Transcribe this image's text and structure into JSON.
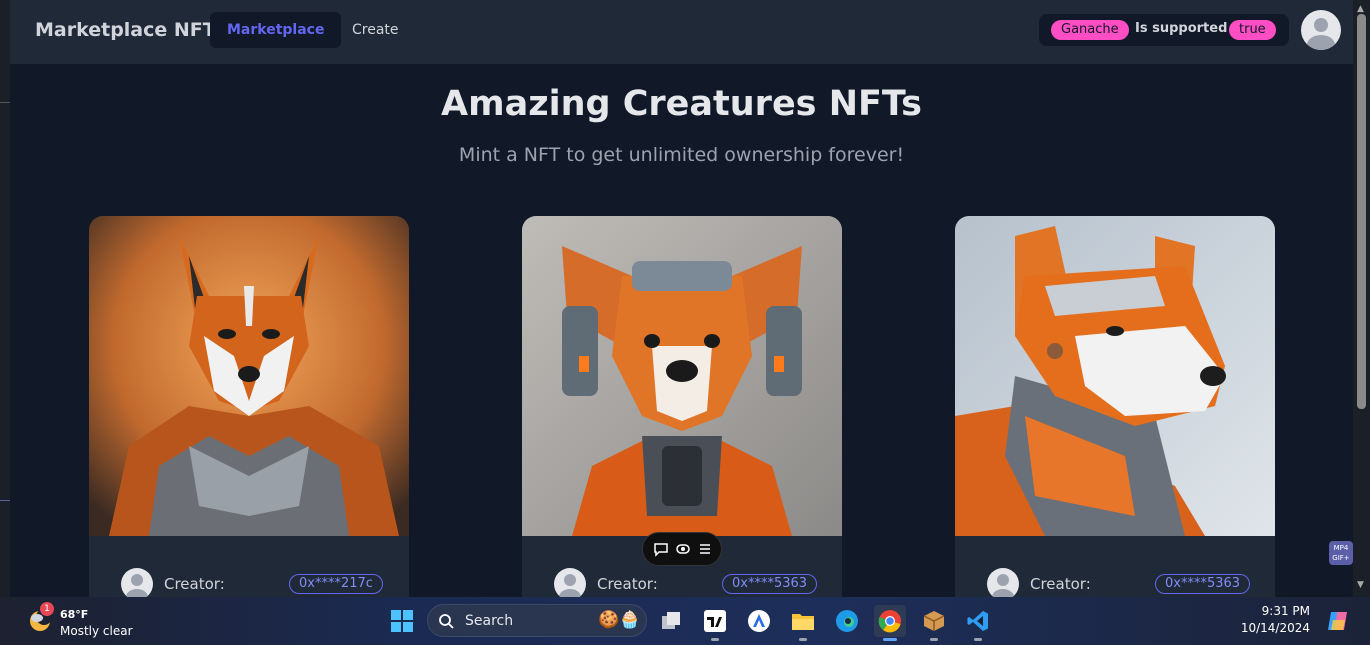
{
  "navbar": {
    "brand": "Marketplace NFT",
    "links": [
      {
        "label": "Marketplace",
        "active": true
      },
      {
        "label": "Create",
        "active": false
      }
    ],
    "network": {
      "name": "Ganache",
      "supported_label": "Is supported :",
      "supported_value": "true"
    }
  },
  "hero": {
    "title": "Amazing Creatures NFTs",
    "subtitle": "Mint a NFT to get unlimited ownership forever!"
  },
  "cards": [
    {
      "creator_label": "Creator:",
      "address": "0x****217c",
      "image": "fox-armor-nft-image"
    },
    {
      "creator_label": "Creator:",
      "address": "0x****5363",
      "image": "robot-dog-nft-image"
    },
    {
      "creator_label": "Creator:",
      "address": "0x****5363",
      "image": "armored-dog-nft-image"
    }
  ],
  "overlay": {
    "mp4_badge": "MP4 GIF+"
  },
  "taskbar": {
    "weather": {
      "temp": "68°F",
      "desc": "Mostly clear",
      "badge": "1"
    },
    "search_placeholder": "Search",
    "apps": [
      "windows-start",
      "task-view",
      "tradingview",
      "app-store",
      "file-explorer",
      "edge",
      "chrome",
      "package-app",
      "vscode"
    ],
    "time": "9:31 PM",
    "date": "10/14/2024"
  },
  "colors": {
    "accent": "#6366f1",
    "pill": "#ff4dc4",
    "navbar_bg": "#1f2937",
    "page_bg": "#111827"
  }
}
